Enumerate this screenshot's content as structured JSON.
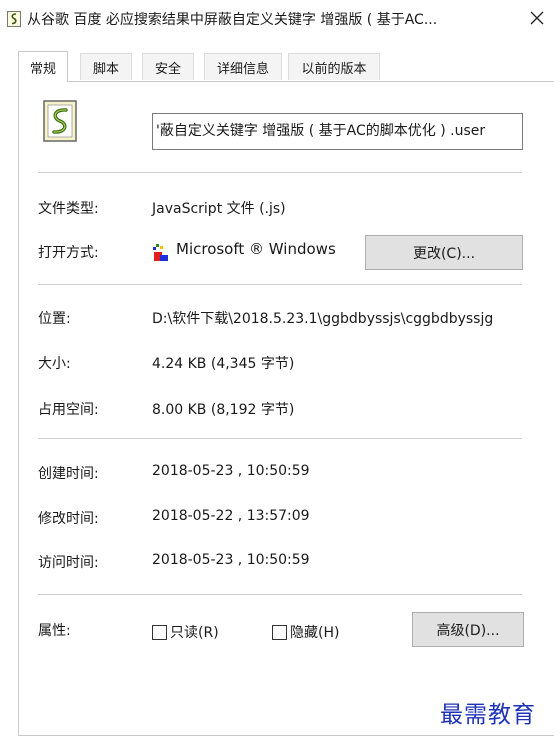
{
  "window": {
    "title": "从谷歌 百度 必应搜索结果中屏蔽自定义关键字 增强版 ( 基于AC...",
    "close_icon": "close-icon",
    "title_icon": "script-file-icon"
  },
  "tabs": [
    {
      "label": "常规",
      "active": true
    },
    {
      "label": "脚本",
      "active": false
    },
    {
      "label": "安全",
      "active": false
    },
    {
      "label": "详细信息",
      "active": false
    },
    {
      "label": "以前的版本",
      "active": false
    }
  ],
  "file": {
    "icon": "javascript-file-icon",
    "name": "'蔽自定义关键字 增强版 ( 基于AC的脚本优化 ) .user"
  },
  "info": {
    "file_type_label": "文件类型:",
    "file_type_value": "JavaScript 文件 (.js)",
    "open_with_label": "打开方式:",
    "open_with_app": "Microsoft ® Windows",
    "open_with_app_icon": "windows-script-host-icon",
    "change_button": "更改(C)...",
    "location_label": "位置:",
    "location_value": "D:\\软件下载\\2018.5.23.1\\ggbdbyssjs\\cggbdbyssjg",
    "size_label": "大小:",
    "size_value": "4.24 KB (4,345 字节)",
    "disk_size_label": "占用空间:",
    "disk_size_value": "8.00 KB (8,192 字节)",
    "created_label": "创建时间:",
    "created_value": "2018-05-23 , 10:50:59",
    "modified_label": "修改时间:",
    "modified_value": "2018-05-22 , 13:57:09",
    "accessed_label": "访问时间:",
    "accessed_value": "2018-05-23 , 10:50:59"
  },
  "attributes": {
    "label": "属性:",
    "readonly_label": "只读(R)",
    "readonly_checked": false,
    "hidden_label": "隐藏(H)",
    "hidden_checked": false,
    "advanced_button": "高级(D)..."
  },
  "watermark": "最需教育",
  "colors": {
    "watermark": "#1f33b8",
    "button_face": "#e1e1e1",
    "separator": "#cfcfcf"
  }
}
